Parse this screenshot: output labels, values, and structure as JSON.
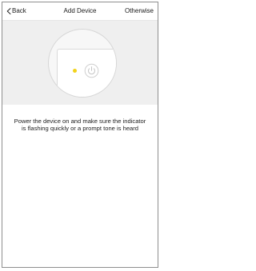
{
  "header": {
    "back_label": "Back",
    "title": "Add Device",
    "other_label": "Otherwise"
  },
  "icons": {
    "back": "chevron-left-icon",
    "power": "power-icon",
    "indicator": "indicator-light-icon"
  },
  "colors": {
    "indicator": "#f2d21b",
    "hero_background": "#efefef"
  },
  "main": {
    "instruction": "Power the device on and make sure the indicator is flashing quickly or a prompt tone is heard"
  }
}
